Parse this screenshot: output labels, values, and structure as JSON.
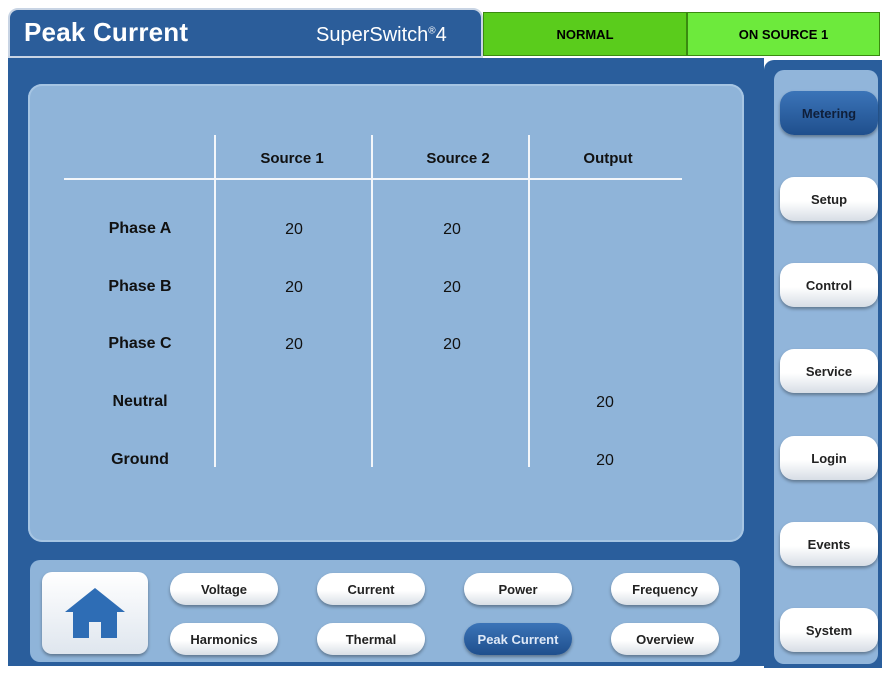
{
  "header": {
    "title": "Peak Current",
    "brand": "SuperSwitch",
    "brand_mark": "®",
    "brand_version": "4",
    "status_mode": "NORMAL",
    "status_source": "ON SOURCE 1"
  },
  "table": {
    "columns": [
      "Source 1",
      "Source 2",
      "Output"
    ],
    "rows": [
      {
        "label": "Phase A",
        "source1": "20",
        "source2": "20",
        "output": ""
      },
      {
        "label": "Phase B",
        "source1": "20",
        "source2": "20",
        "output": ""
      },
      {
        "label": "Phase C",
        "source1": "20",
        "source2": "20",
        "output": ""
      },
      {
        "label": "Neutral",
        "source1": "",
        "source2": "",
        "output": "20"
      },
      {
        "label": "Ground",
        "source1": "",
        "source2": "",
        "output": "20"
      }
    ]
  },
  "bottom_nav": {
    "home_icon": "home-icon",
    "buttons": [
      "Voltage",
      "Current",
      "Power",
      "Frequency",
      "Harmonics",
      "Thermal",
      "Peak Current",
      "Overview"
    ],
    "active": "Peak Current"
  },
  "side_nav": {
    "buttons": [
      "Metering",
      "Setup",
      "Control",
      "Service",
      "Login",
      "Events",
      "System"
    ],
    "active": "Metering"
  },
  "colors": {
    "frame_blue": "#2a5e9c",
    "panel_blue": "#8fb4d9",
    "status_normal_green": "#5acc1c",
    "status_source_green": "#6dea3c"
  }
}
